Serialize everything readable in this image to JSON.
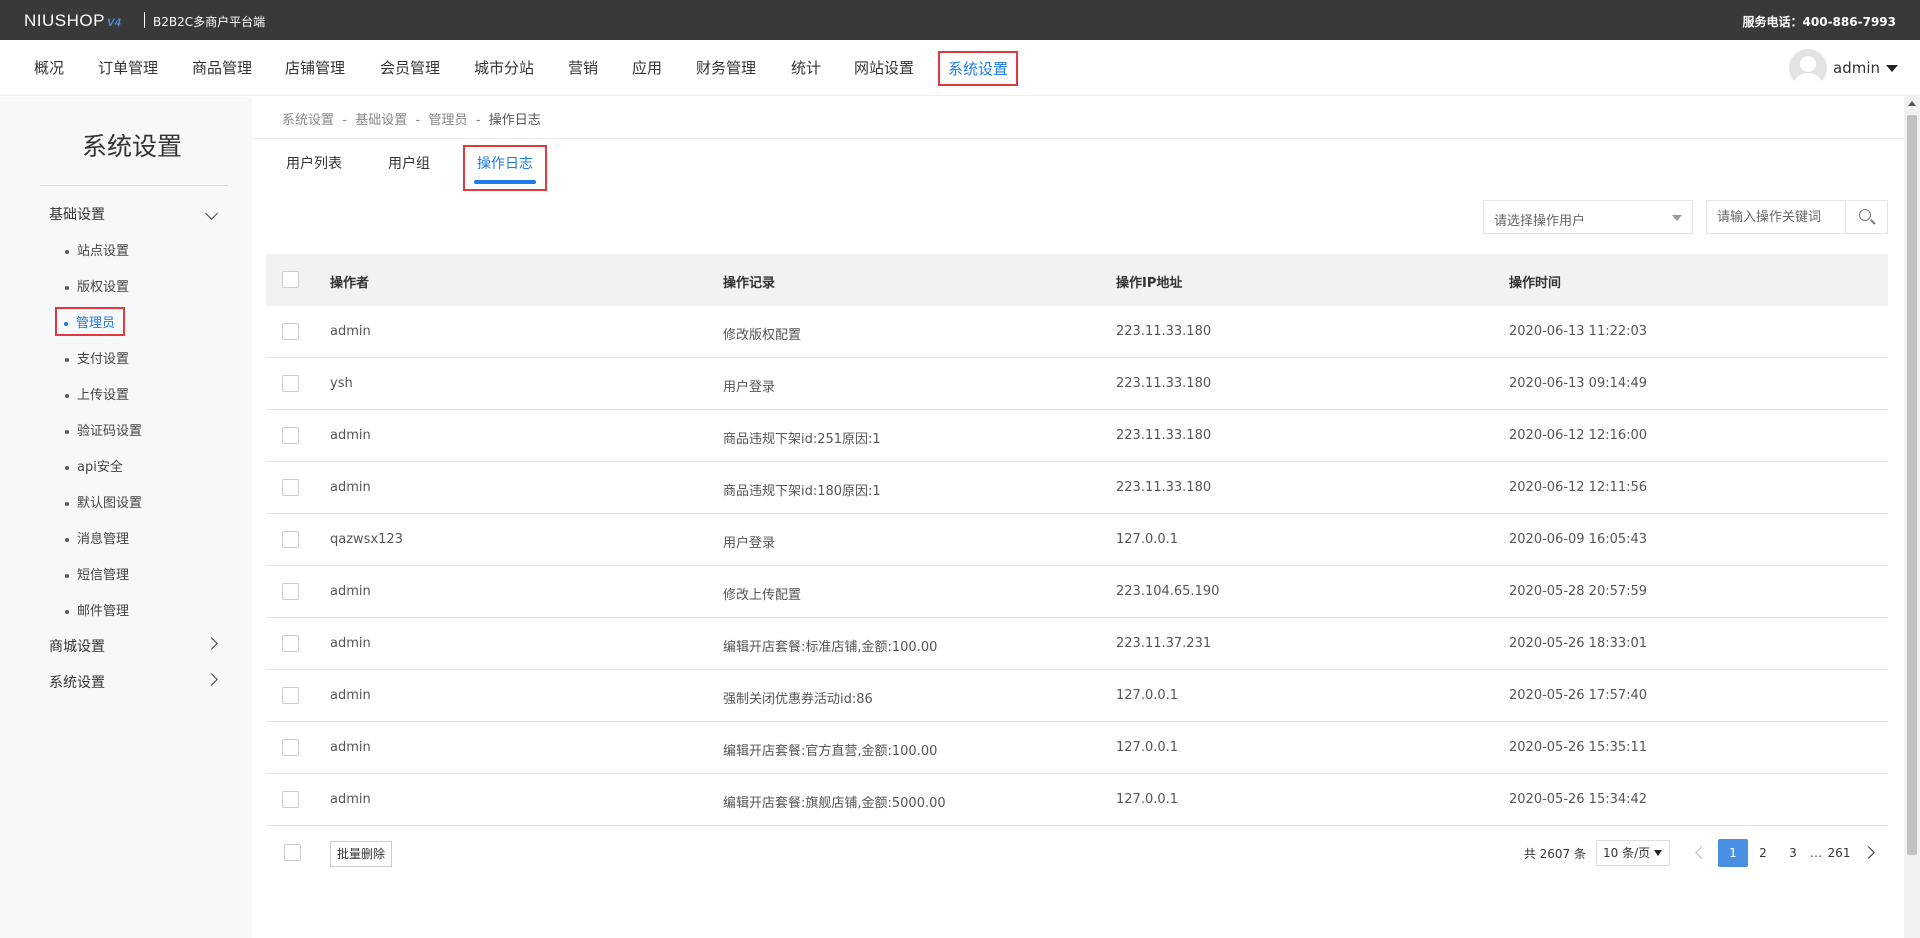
{
  "topbar": {
    "logo": "NIUSHOP",
    "logo_version": "V4",
    "subtitle": "B2B2C多商户平台端",
    "hotline": "服务电话：400-886-7993"
  },
  "nav": {
    "items": [
      "概况",
      "订单管理",
      "商品管理",
      "店铺管理",
      "会员管理",
      "城市分站",
      "营销",
      "应用",
      "财务管理",
      "统计",
      "网站设置",
      "系统设置"
    ],
    "user": "admin"
  },
  "sidebar": {
    "title": "系统设置",
    "group1": "基础设置",
    "subitems": [
      "站点设置",
      "版权设置",
      "管理员",
      "支付设置",
      "上传设置",
      "验证码设置",
      "api安全",
      "默认图设置",
      "消息管理",
      "短信管理",
      "邮件管理"
    ],
    "group2": "商城设置",
    "group3": "系统设置"
  },
  "breadcrumb": [
    "系统设置",
    "基础设置",
    "管理员",
    "操作日志"
  ],
  "tabs": [
    "用户列表",
    "用户组",
    "操作日志"
  ],
  "filters": {
    "user_select_placeholder": "请选择操作用户",
    "keyword_placeholder": "请输入操作关键词"
  },
  "table": {
    "headers": [
      "操作者",
      "操作记录",
      "操作IP地址",
      "操作时间"
    ],
    "rows": [
      [
        "admin",
        "修改版权配置",
        "223.11.33.180",
        "2020-06-13 11:22:03"
      ],
      [
        "ysh",
        "用户登录",
        "223.11.33.180",
        "2020-06-13 09:14:49"
      ],
      [
        "admin",
        "商品违规下架id:251原因:1",
        "223.11.33.180",
        "2020-06-12 12:16:00"
      ],
      [
        "admin",
        "商品违规下架id:180原因:1",
        "223.11.33.180",
        "2020-06-12 12:11:56"
      ],
      [
        "qazwsx123",
        "用户登录",
        "127.0.0.1",
        "2020-06-09 16:05:43"
      ],
      [
        "admin",
        "修改上传配置",
        "223.104.65.190",
        "2020-05-28 20:57:59"
      ],
      [
        "admin",
        "编辑开店套餐:标准店铺,金额:100.00",
        "223.11.37.231",
        "2020-05-26 18:33:01"
      ],
      [
        "admin",
        "强制关闭优惠券活动id:86",
        "127.0.0.1",
        "2020-05-26 17:57:40"
      ],
      [
        "admin",
        "编辑开店套餐:官方直营,金额:100.00",
        "127.0.0.1",
        "2020-05-26 15:35:11"
      ],
      [
        "admin",
        "编辑开店套餐:旗舰店铺,金额:5000.00",
        "127.0.0.1",
        "2020-05-26 15:34:42"
      ]
    ]
  },
  "footer": {
    "batch_delete": "批量删除",
    "total": "共 2607 条",
    "page_size": "10 条/页",
    "pages": [
      "1",
      "2",
      "3",
      "…",
      "261"
    ],
    "current_page": "1"
  },
  "colors": {
    "accent": "#1e7ae8",
    "highlight_border": "#e4393c",
    "topbar": "#393939"
  },
  "icons": [
    "search-icon",
    "chevron-down-icon",
    "chevron-right-icon",
    "caret-down-icon",
    "avatar"
  ]
}
